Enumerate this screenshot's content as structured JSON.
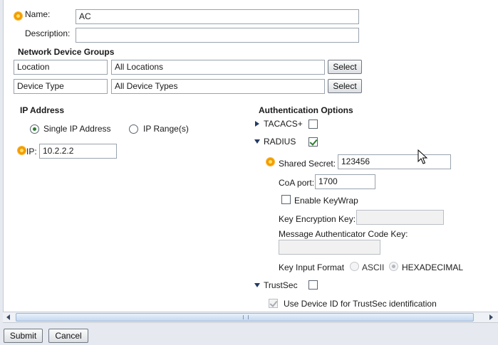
{
  "form": {
    "name_label": "Name:",
    "name_value": "AC",
    "description_label": "Description:",
    "description_value": ""
  },
  "ndg": {
    "title": "Network Device Groups",
    "rows": [
      {
        "label": "Location",
        "value": "All Locations",
        "button": "Select"
      },
      {
        "label": "Device Type",
        "value": "All Device Types",
        "button": "Select"
      }
    ]
  },
  "ip": {
    "title": "IP Address",
    "single_label": "Single IP Address",
    "range_label": "IP Range(s)",
    "selected": "single",
    "ip_label": "IP:",
    "ip_value": "10.2.2.2"
  },
  "auth": {
    "title": "Authentication Options",
    "tacacs": {
      "label": "TACACS+",
      "checked": false,
      "expanded": false
    },
    "radius": {
      "label": "RADIUS",
      "checked": true,
      "expanded": true,
      "shared_secret_label": "Shared Secret:",
      "shared_secret_value": "123456",
      "coa_label": "CoA port:",
      "coa_value": "1700",
      "keywrap_label": "Enable KeyWrap",
      "keywrap_checked": false,
      "kek_label": "Key Encryption Key:",
      "kek_value": "",
      "mack_label": "Message Authenticator Code Key:",
      "mack_value": "",
      "key_format_label": "Key Input Format",
      "ascii_label": "ASCII",
      "hex_label": "HEXADECIMAL",
      "key_format_selected": "HEXADECIMAL"
    },
    "trustsec": {
      "label": "TrustSec",
      "checked": false,
      "expanded": true,
      "device_id_label": "Use Device ID for TrustSec identification",
      "device_id_checked": true
    }
  },
  "footer": {
    "submit": "Submit",
    "cancel": "Cancel"
  },
  "colors": {
    "required": "#f29a00",
    "check": "#2e7d32",
    "triangle": "#233a63"
  }
}
